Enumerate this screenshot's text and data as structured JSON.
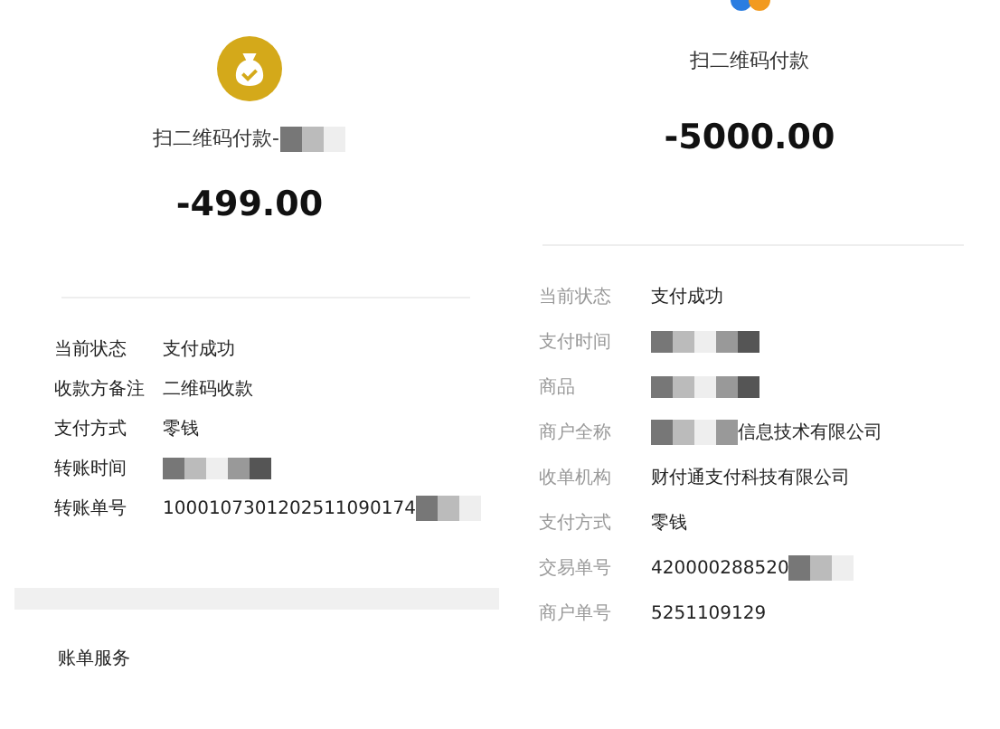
{
  "panels": [
    {
      "kind": "wallet",
      "title": "扫二维码付款-",
      "title_masked": true,
      "amount": "-499.00",
      "rows": [
        {
          "kind": "text",
          "label": "当前状态",
          "value": "支付成功"
        },
        {
          "kind": "text",
          "label": "收款方备注",
          "value": "二维码收款"
        },
        {
          "kind": "text",
          "label": "支付方式",
          "value": "零钱"
        },
        {
          "kind": "masked",
          "label": "转账时间"
        },
        {
          "kind": "text_masked",
          "label": "转账单号",
          "value": "1000107301202511090174"
        }
      ],
      "section": "账单服务"
    },
    {
      "kind": "merchant",
      "title": "扫二维码付款",
      "title_masked": false,
      "amount": "-5000.00",
      "rows": [
        {
          "kind": "text",
          "label": "当前状态",
          "value": "支付成功"
        },
        {
          "kind": "masked",
          "label": "支付时间"
        },
        {
          "kind": "masked",
          "label": "商品"
        },
        {
          "kind": "masked_text",
          "label": "商户全称",
          "value": "信息技术有限公司"
        },
        {
          "kind": "text",
          "label": "收单机构",
          "value": "财付通支付科技有限公司"
        },
        {
          "kind": "text",
          "label": "支付方式",
          "value": "零钱"
        },
        {
          "kind": "text_masked",
          "label": "交易单号",
          "value": "420000288520"
        },
        {
          "kind": "text",
          "label": "商户单号",
          "value": "5251109129"
        }
      ]
    }
  ]
}
